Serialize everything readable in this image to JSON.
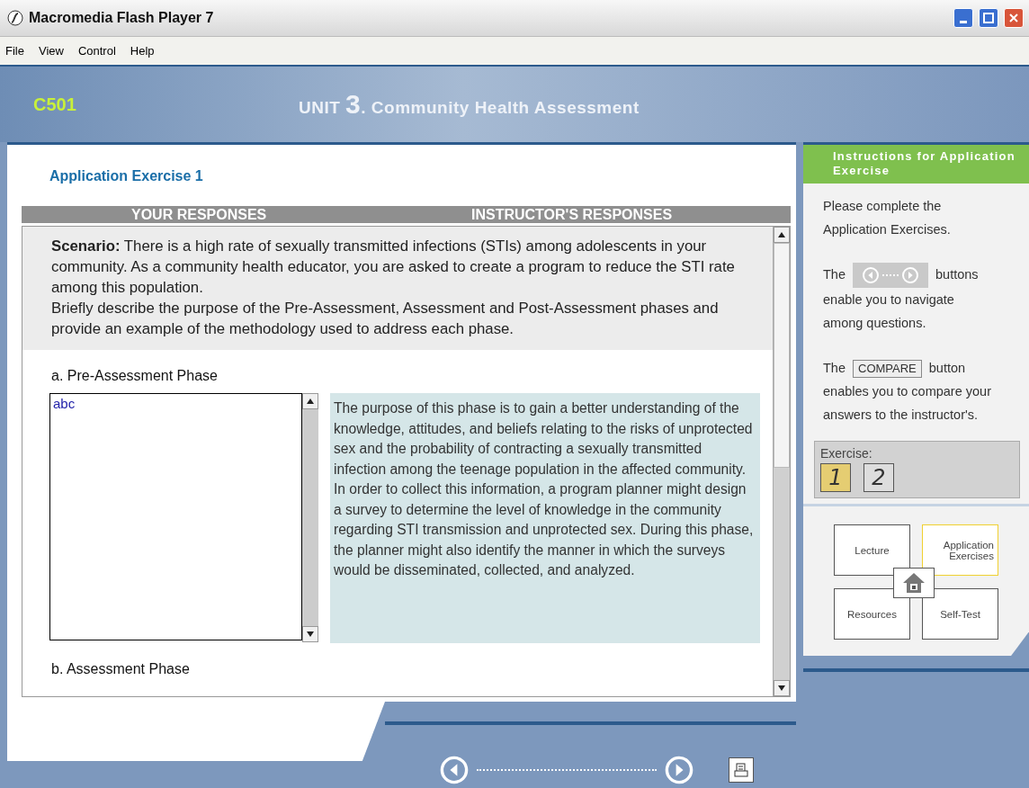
{
  "window": {
    "title": "Macromedia Flash Player 7"
  },
  "menu": [
    "File",
    "View",
    "Control",
    "Help"
  ],
  "header": {
    "course": "C501",
    "unit_label": "UNIT",
    "unit_number": "3",
    "unit_title": ". Community Health Assessment"
  },
  "exercise": {
    "title": "Application Exercise 1",
    "columns": [
      "YOUR RESPONSES",
      "INSTRUCTOR'S RESPONSES"
    ],
    "scenario": "**Scenario:**  There is a high rate of sexually transmitted infections (STIs) among adolescents in your community.  As a community health educator, you are asked to create a program to reduce the STI rate among this population.",
    "prompt": "Briefly describe the purpose of the Pre-Assessment, Assessment and Post-Assessment phases and provide an example of the methodology used to address each phase.",
    "questions": [
      {
        "label": "a.  Pre-Assessment Phase",
        "answer": "abc",
        "instructor_response": "The purpose of this phase is to gain a better understanding of the knowledge, attitudes, and beliefs relating to the risks of unprotected sex and the probability of contracting a sexually transmitted infection among the teenage population in the affected community.  In order to collect this information, a program planner might design a survey to determine the level of knowledge in the community regarding STI transmission and unprotected sex.  During this phase, the planner might also identify the manner in which the surveys would be disseminated, collected, and analyzed."
      },
      {
        "label": "b.  Assessment Phase"
      }
    ]
  },
  "sidebar": {
    "title": "Instructions for Application Exercise",
    "intro": "Please complete the Application Exercises.",
    "nav_hint": {
      "before": "The",
      "after": "buttons",
      "rest": "enable you to navigate among questions."
    },
    "compare_hint": {
      "before": "The",
      "button": "COMPARE",
      "after": "button",
      "rest": "enables you to compare your answers to the instructor's."
    },
    "picker": {
      "label": "Exercise:",
      "items": [
        {
          "label": "1",
          "selected": true
        },
        {
          "label": "2",
          "selected": false
        }
      ]
    },
    "map": [
      {
        "label": "Lecture",
        "selected": false
      },
      {
        "label": "Application Exercises",
        "selected": true
      },
      {
        "label": "Resources",
        "selected": false
      },
      {
        "label": "Self-Test",
        "selected": false
      }
    ]
  }
}
